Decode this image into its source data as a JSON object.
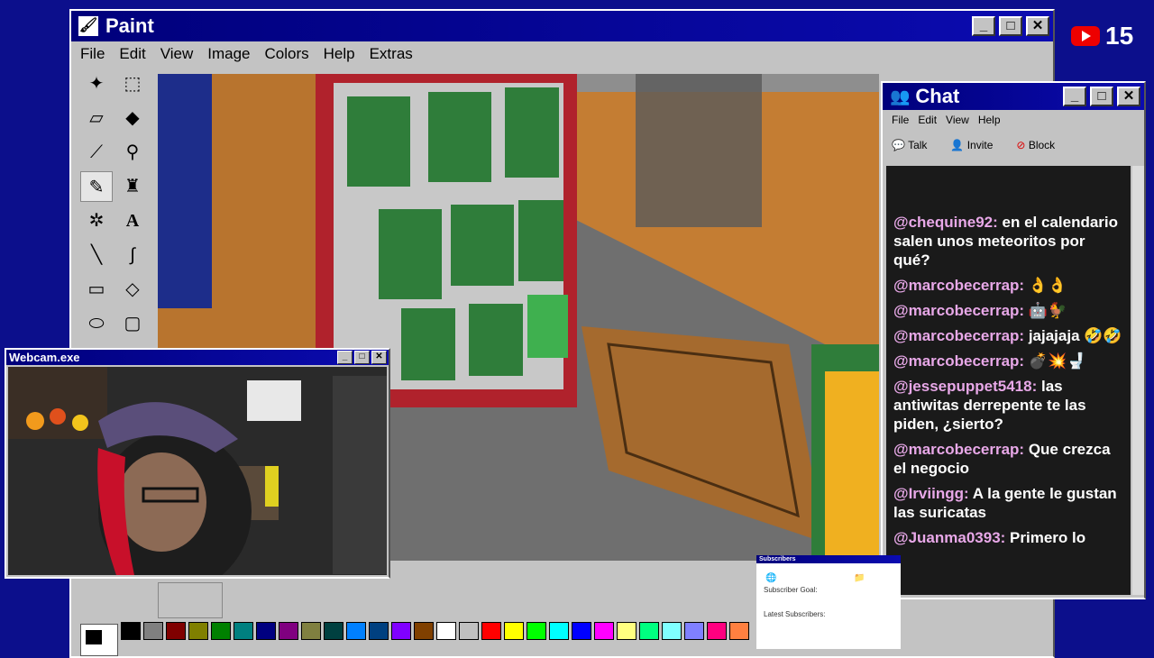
{
  "paint": {
    "title": "Paint",
    "menu": [
      "File",
      "Edit",
      "View",
      "Image",
      "Colors",
      "Help",
      "Extras"
    ],
    "tools": [
      {
        "name": "free-select-icon",
        "glyph": "✦"
      },
      {
        "name": "rect-select-icon",
        "glyph": "⬚"
      },
      {
        "name": "eraser-icon",
        "glyph": "▱"
      },
      {
        "name": "fill-bucket-icon",
        "glyph": "◆"
      },
      {
        "name": "color-picker-icon",
        "glyph": "⟋"
      },
      {
        "name": "magnifier-icon",
        "glyph": "⚲"
      },
      {
        "name": "pencil-icon",
        "glyph": "✎"
      },
      {
        "name": "brush-icon",
        "glyph": "♜"
      },
      {
        "name": "airbrush-icon",
        "glyph": "✲"
      },
      {
        "name": "text-icon",
        "glyph": "A"
      },
      {
        "name": "line-icon",
        "glyph": "╲"
      },
      {
        "name": "curve-icon",
        "glyph": "∫"
      },
      {
        "name": "rectangle-icon",
        "glyph": "▭"
      },
      {
        "name": "polygon-icon",
        "glyph": "◇"
      },
      {
        "name": "ellipse-icon",
        "glyph": "⬭"
      },
      {
        "name": "rounded-rect-icon",
        "glyph": "▢"
      }
    ],
    "palette": [
      "#000000",
      "#808080",
      "#800000",
      "#808000",
      "#008000",
      "#008080",
      "#000080",
      "#800080",
      "#808040",
      "#004040",
      "#0080ff",
      "#004080",
      "#8000ff",
      "#804000",
      "#ffffff",
      "#c0c0c0",
      "#ff0000",
      "#ffff00",
      "#00ff00",
      "#00ffff",
      "#0000ff",
      "#ff00ff",
      "#ffff80",
      "#00ff80",
      "#80ffff",
      "#8080ff",
      "#ff0080",
      "#ff8040"
    ]
  },
  "chat": {
    "title": "Chat",
    "menu": [
      "File",
      "Edit",
      "View",
      "Help"
    ],
    "actions": [
      {
        "label": "Talk",
        "icon": "talk-icon"
      },
      {
        "label": "Invite",
        "icon": "invite-icon"
      },
      {
        "label": "Block",
        "icon": "block-icon"
      }
    ],
    "messages": [
      {
        "user": "@chequine92:",
        "text": "en el calendario salen unos meteoritos por qué?"
      },
      {
        "user": "@marcobecerrap:",
        "text": "👌👌"
      },
      {
        "user": "@marcobecerrap:",
        "text": "🤖🐓"
      },
      {
        "user": "@marcobecerrap:",
        "text": "jajajaja 🤣🤣"
      },
      {
        "user": "@marcobecerrap:",
        "text": "💣💥🚽"
      },
      {
        "user": "@jessepuppet5418:",
        "text": "las antiwitas derrepente te las piden, ¿sierto?"
      },
      {
        "user": "@marcobecerrap:",
        "text": "Que crezca el negocio"
      },
      {
        "user": "@Irviingg:",
        "text": "A la gente le gustan las suricatas"
      },
      {
        "user": "@Juanma0393:",
        "text": "Primero lo"
      }
    ]
  },
  "webcam": {
    "title": "Webcam.exe"
  },
  "subscribers": {
    "title": "Subscribers",
    "goal_label": "Subscriber Goal:",
    "latest_label": "Latest Subscribers:"
  },
  "badge": {
    "count": "15"
  }
}
